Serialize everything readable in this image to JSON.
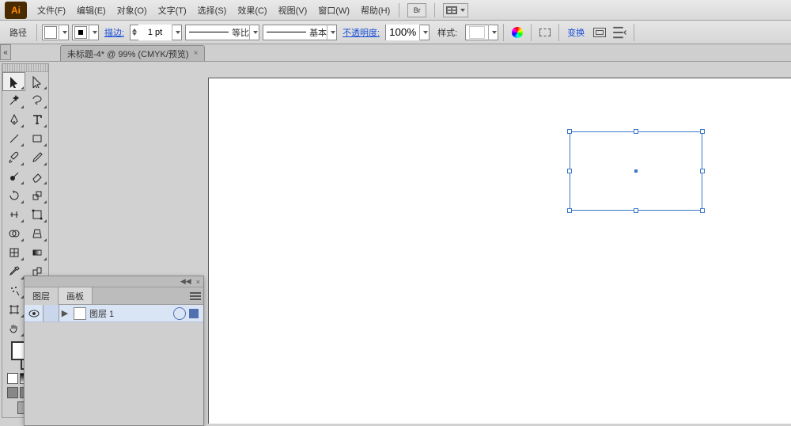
{
  "app": {
    "logo": "Ai"
  },
  "menu": {
    "file": "文件(F)",
    "edit": "编辑(E)",
    "object": "对象(O)",
    "type": "文字(T)",
    "select": "选择(S)",
    "effect": "效果(C)",
    "view": "视图(V)",
    "window": "窗口(W)",
    "help": "帮助(H)",
    "bridge_label": "Br"
  },
  "options": {
    "tool_label": "路径",
    "stroke_label": "描边:",
    "stroke_value": "1 pt",
    "brush_equal_label": "等比",
    "brush_basic_label": "基本",
    "opacity_label": "不透明度:",
    "opacity_value": "100%",
    "style_label": "样式:",
    "transform_label": "变换"
  },
  "document": {
    "tab_title": "未标题-4* @ 99% (CMYK/预览)"
  },
  "layers_panel": {
    "tab_layers": "图层",
    "tab_artboards": "画板",
    "layer1_name": "图层 1"
  },
  "tools": [
    "selection",
    "direct-selection",
    "magic-wand",
    "lasso",
    "pen",
    "type",
    "line",
    "rectangle",
    "paintbrush",
    "pencil",
    "blob-brush",
    "eraser",
    "rotate",
    "scale",
    "width",
    "free-transform",
    "shape-builder",
    "perspective",
    "mesh",
    "gradient",
    "eyedropper",
    "blend",
    "symbol-sprayer",
    "column-graph",
    "artboard",
    "slice",
    "hand",
    "zoom"
  ]
}
